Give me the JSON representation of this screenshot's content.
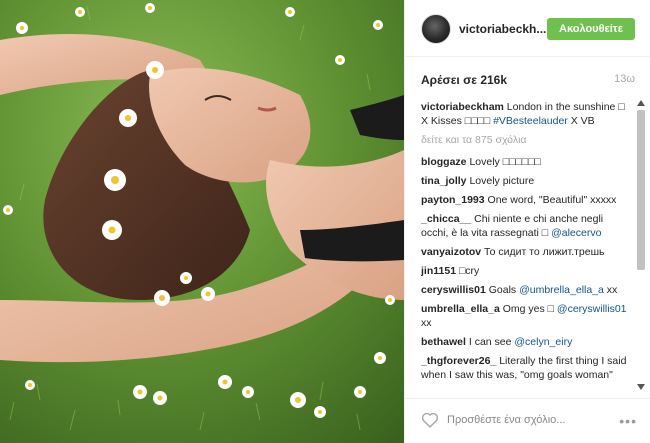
{
  "post": {
    "photo_alt": "",
    "username": "victoriabeckh...",
    "follow_label": "Ακολουθείτε",
    "likes": "Αρέσει σε 216k",
    "time_ago": "13ω"
  },
  "caption": {
    "user": "victoriabeckham",
    "text": "London in the sunshine □ X Kisses □□□□ ",
    "hashtag": "#VBesteelauder",
    "suffix": " X VB"
  },
  "view_all": "δείτε και τα 875 σχόλια",
  "comments": [
    {
      "user": "bloggaze",
      "text": "Lovely □□□□□□"
    },
    {
      "user": "tina_jolly",
      "text": "Lovely picture"
    },
    {
      "user": "payton_1993",
      "text": "One word, \"Beautiful\" xxxxx"
    },
    {
      "user": "_chicca__",
      "text": "Chi niente e chi anche negli occhi, è la vita rassegnati □ ",
      "mention": "@alecervo"
    },
    {
      "user": "vanyaizotov",
      "text": "То сидит то лижит.трешь"
    },
    {
      "user": "jin1151",
      "text": "□cry"
    },
    {
      "user": "ceryswillis01",
      "text": "Goals ",
      "mention": "@umbrella_ella_a",
      "after": " xx"
    },
    {
      "user": "umbrella_ella_a",
      "text": "Omg yes □ ",
      "mention": "@ceryswillis01",
      "after": " xx"
    },
    {
      "user": "bethawel",
      "text": "I can see ",
      "mention": "@celyn_eiry"
    },
    {
      "user": "_thgforever26_",
      "text": "Literally the first thing I said when I saw this was, \"omg goals woman\""
    }
  ],
  "footer": {
    "comment_placeholder": "Προσθέστε ένα σχόλιο...",
    "heart_icon": "heart-outline-icon",
    "more_icon": "more-dots-icon"
  },
  "colors": {
    "follow_green": "#70c050",
    "link_blue": "#125688",
    "muted_gray": "#a5a7aa"
  }
}
